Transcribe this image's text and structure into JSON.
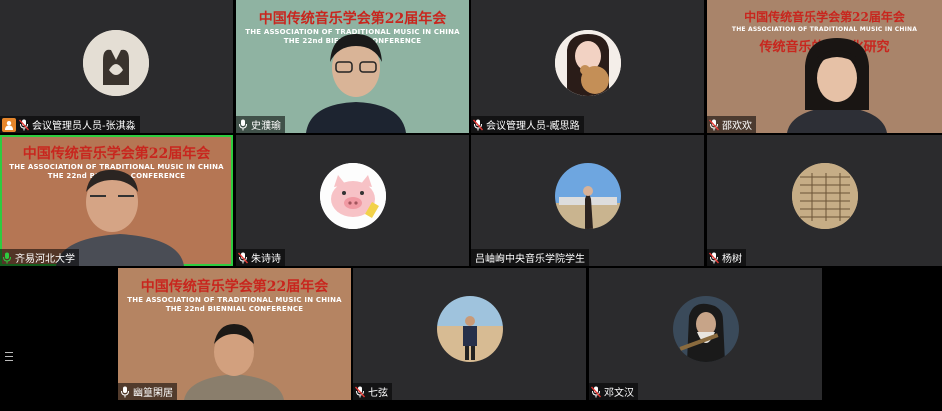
{
  "participants": [
    {
      "name": "会议管理员人员-张淇淼",
      "mic": "muted",
      "host": true
    },
    {
      "name": "史濮瑜",
      "mic": "on",
      "host": false
    },
    {
      "name": "会议管理人员-臧思路",
      "mic": "muted",
      "host": false
    },
    {
      "name": "邵欢欢",
      "mic": "muted",
      "host": false
    },
    {
      "name": "齐易河北大学",
      "mic": "active",
      "host": false
    },
    {
      "name": "朱诗诗",
      "mic": "muted",
      "host": false
    },
    {
      "name": "吕岫峋中央音乐学院学生",
      "mic": "none",
      "host": false
    },
    {
      "name": "杨树",
      "mic": "muted",
      "host": false
    },
    {
      "name": "幽篁閑居",
      "mic": "on",
      "host": false
    },
    {
      "name": "七弦",
      "mic": "muted",
      "host": false
    },
    {
      "name": "邓文汉",
      "mic": "muted",
      "host": false
    }
  ],
  "backgrounds": {
    "cn_title": "中国传统音乐学会第22届年会",
    "en_title": "THE ASSOCIATION OF TRADITIONAL MUSIC IN CHINA",
    "en_subtitle": "THE 22nd BIENNIAL CONFERENCE",
    "cn_topic": "传统音乐的跨文化研究"
  },
  "colors": {
    "active_speaker": "#2ecc40",
    "tile_bg": "#2b2b2d",
    "banner_red": "#c8261e",
    "host_badge": "#e6862b"
  }
}
